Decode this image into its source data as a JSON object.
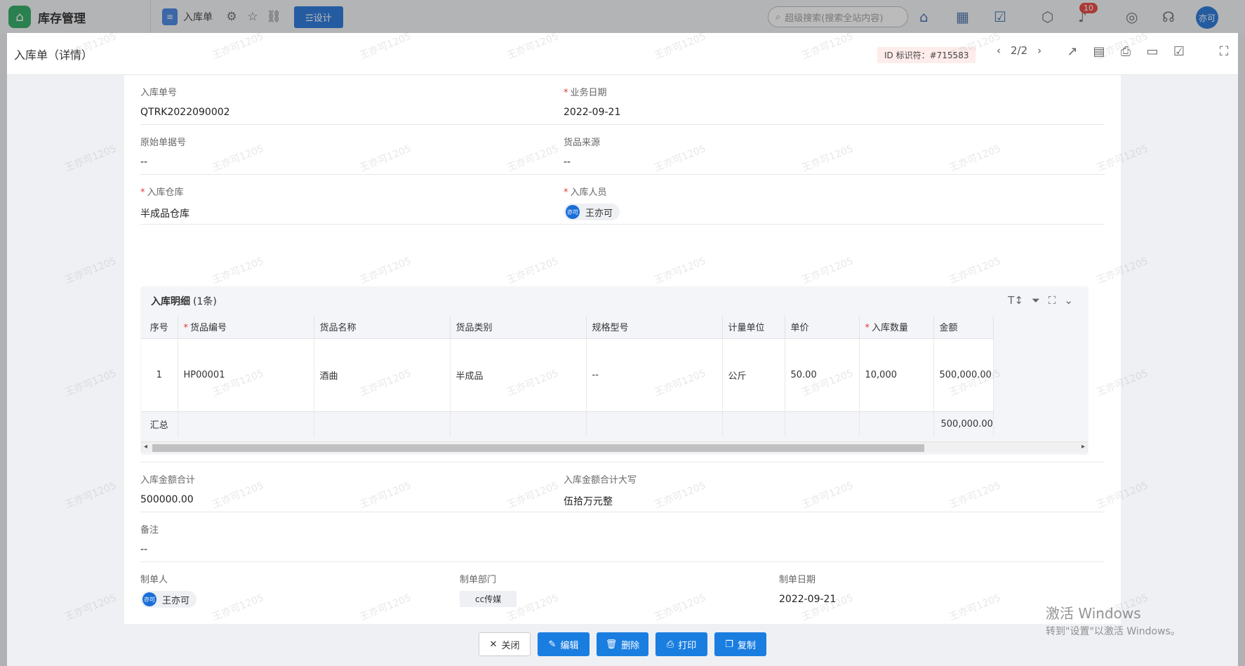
{
  "app": {
    "name": "库存管理"
  },
  "topbar": {
    "tab_label": "入库单",
    "design_label": "☲设计",
    "search_placeholder": "超级搜索(搜索全站内容)",
    "notification_count": "10",
    "avatar_text": "亦可"
  },
  "dialog": {
    "title": "入库单（详情）",
    "id_tag": "ID 标识符：#715583",
    "pager": "2/2"
  },
  "fields": {
    "order_no": {
      "label": "入库单号",
      "value": "QTRK2022090002"
    },
    "biz_date": {
      "label": "业务日期",
      "value": "2022-09-21"
    },
    "orig_no": {
      "label": "原始单据号",
      "value": "--"
    },
    "source": {
      "label": "货品来源",
      "value": "--"
    },
    "warehouse": {
      "label": "入库仓库",
      "value": "半成品仓库"
    },
    "staff": {
      "label": "入库人员",
      "value": "王亦可",
      "avatar": "亦可"
    },
    "total": {
      "label": "入库金额合计",
      "value": "500000.00"
    },
    "total_upper": {
      "label": "入库金额合计大写",
      "value": "伍拾万元整"
    },
    "remark": {
      "label": "备注",
      "value": "--"
    },
    "creator": {
      "label": "制单人",
      "value": "王亦可",
      "avatar": "亦可"
    },
    "dept": {
      "label": "制单部门",
      "value": "cc传媒"
    },
    "create_date": {
      "label": "制单日期",
      "value": "2022-09-21"
    }
  },
  "detail": {
    "title": "入库明细",
    "count": "(1条)",
    "columns": [
      "序号",
      "货品编号",
      "货品名称",
      "货品类别",
      "规格型号",
      "计量单位",
      "单价",
      "入库数量",
      "金额"
    ],
    "rows": [
      [
        "1",
        "HP00001",
        "酒曲",
        "半成品",
        "--",
        "公斤",
        "50.00",
        "10,000",
        "500,000.00"
      ]
    ],
    "summary_label": "汇总",
    "summary_amount": "500,000.00"
  },
  "footer": {
    "close": "关闭",
    "edit": "编辑",
    "delete": "删除",
    "print": "打印",
    "copy": "复制"
  },
  "watermark": "王亦可1205",
  "windows_activation": {
    "line1": "激活 Windows",
    "line2": "转到\"设置\"以激活 Windows。"
  }
}
